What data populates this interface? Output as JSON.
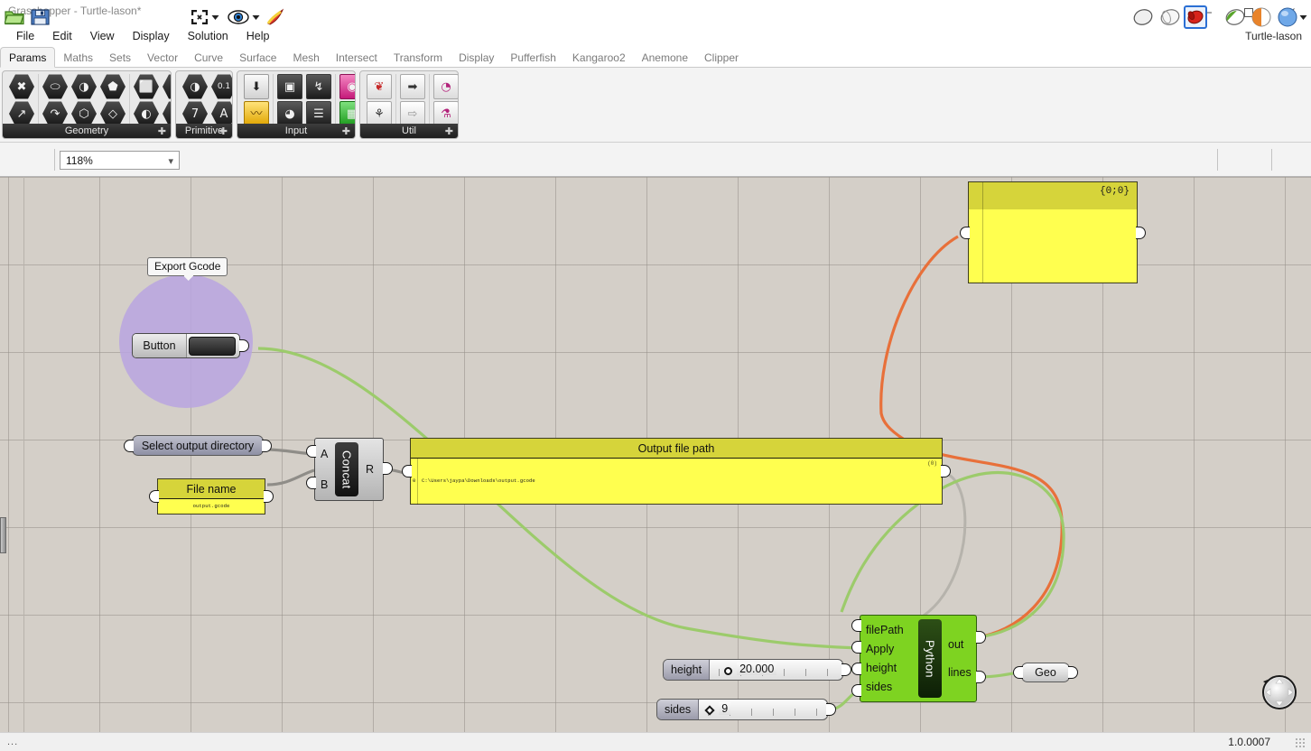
{
  "window": {
    "title": "Grasshopper - Turtle-lason*",
    "minimize": "—",
    "maximize": "☐",
    "close": "✕"
  },
  "menu": {
    "items": [
      "File",
      "Edit",
      "View",
      "Display",
      "Solution",
      "Help"
    ],
    "document_label": "Turtle-lason"
  },
  "tabs": [
    {
      "label": "Params",
      "active": true
    },
    {
      "label": "Maths",
      "active": false
    },
    {
      "label": "Sets",
      "active": false
    },
    {
      "label": "Vector",
      "active": false
    },
    {
      "label": "Curve",
      "active": false
    },
    {
      "label": "Surface",
      "active": false
    },
    {
      "label": "Mesh",
      "active": false
    },
    {
      "label": "Intersect",
      "active": false
    },
    {
      "label": "Transform",
      "active": false
    },
    {
      "label": "Display",
      "active": false
    },
    {
      "label": "Pufferfish",
      "active": false
    },
    {
      "label": "Kangaroo2",
      "active": false
    },
    {
      "label": "Anemone",
      "active": false
    },
    {
      "label": "Clipper",
      "active": false
    }
  ],
  "ribbon": {
    "panels": [
      {
        "name": "Geometry",
        "plus": "✦",
        "groups": [
          {
            "rows": [
              [
                "✖"
              ],
              [
                "↗"
              ]
            ]
          },
          {
            "rows": [
              [
                "⬭",
                "◑",
                "⬟"
              ],
              [
                "↷",
                "⬡",
                "◇"
              ]
            ]
          },
          {
            "rows": [
              [
                "⬛",
                "❄"
              ],
              [
                "◐",
                "◥"
              ]
            ]
          }
        ]
      },
      {
        "name": "Primitive",
        "plus": "✦",
        "groups": [
          {
            "rows": [
              [
                "◐",
                "0.1"
              ],
              [
                "7",
                "A"
              ]
            ]
          }
        ]
      },
      {
        "name": "Input",
        "plus": "✦",
        "groups": [
          {
            "rows": [
              [
                "⬇"
              ],
              [
                "〰"
              ]
            ]
          },
          {
            "rows": [
              [
                "▣",
                "↯"
              ],
              [
                "◕",
                "☰"
              ]
            ]
          },
          {
            "rows": [
              [
                "◉"
              ],
              [
                "▦"
              ]
            ]
          }
        ]
      },
      {
        "name": "Util",
        "plus": "✦",
        "groups": [
          {
            "rows": [
              [
                "❦"
              ],
              [
                "⚘"
              ]
            ]
          },
          {
            "rows": [
              [
                "➡"
              ],
              [
                "⇨"
              ]
            ]
          },
          {
            "rows": [
              [
                "◔"
              ],
              [
                "⚗"
              ]
            ]
          }
        ]
      }
    ]
  },
  "toolbar": {
    "open_icon": "folder-open-icon",
    "save_icon": "save-icon",
    "zoom_value": "118%",
    "zoom_chevron": "⌄",
    "fit_icon": "zoom-extents-icon",
    "preview_icon": "preview-eye-icon",
    "bake_icon": "bake-icon",
    "right_icons": [
      "shaded-preview-icon",
      "wireframe-preview-icon",
      "preview-mesh-icon",
      "transparent-preview-icon",
      "sphere-material-icon",
      "preview-color-icon"
    ]
  },
  "canvas": {
    "group": {
      "label": "Export Gcode",
      "color": "#b9a5e0"
    },
    "button_component": {
      "name": "Button",
      "label": "Button"
    },
    "select_output_directory": {
      "label": "Select output directory"
    },
    "file_name_panel": {
      "title": "File name",
      "value": "output.gcode"
    },
    "concat_component": {
      "title": "Concat",
      "inputs": [
        "A",
        "B"
      ],
      "outputs": [
        "R"
      ]
    },
    "output_file_path_panel": {
      "title": "Output file path",
      "index": "0",
      "value": "C:\\Users\\jaypa\\Downloads\\output.gcode",
      "count": "(0)"
    },
    "empty_panel": {
      "path_header": "{0;0}",
      "value": ""
    },
    "python_component": {
      "title": "Python",
      "inputs": [
        "filePath",
        "Apply",
        "height",
        "sides"
      ],
      "outputs": [
        "out",
        "lines"
      ]
    },
    "geo_param": {
      "label": "Geo"
    },
    "sliders": [
      {
        "name": "height",
        "label": "height",
        "value": "20.000",
        "grip": "circle",
        "grip_pos_pct": 16
      },
      {
        "name": "sides",
        "label": "sides",
        "value": "9",
        "grip": "diamond",
        "grip_pos_pct": 2
      }
    ],
    "wire_colors": {
      "data": "#9ccb6b",
      "warning": "#e8703a",
      "grey": "#8f8d88"
    }
  },
  "statusbar": {
    "left": "...",
    "version": "1.0.0007"
  }
}
